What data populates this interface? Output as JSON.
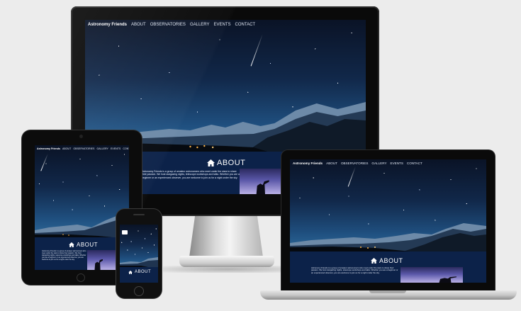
{
  "site": {
    "brand": "Astronomy Friends",
    "nav_links": [
      "ABOUT",
      "OBSERVATORIES",
      "GALLERY",
      "EVENTS",
      "CONTACT"
    ],
    "about_heading": "ABOUT",
    "about_text": "Astronomy Friends is a group of amateur astronomers who meet under the stars to share their passion. We host stargazing nights, telescope workshops and talks. Whether you are a beginner or an experienced observer, you are welcome to join us for a night under the sky."
  },
  "devices": [
    "imac",
    "ipad",
    "iphone",
    "macbook"
  ],
  "icons": {
    "home": "home-icon",
    "menu": "menu-toggle-icon"
  },
  "colors": {
    "background": "#ececec",
    "about_band": "#0c2249",
    "bezel": "#0a0a0a"
  }
}
